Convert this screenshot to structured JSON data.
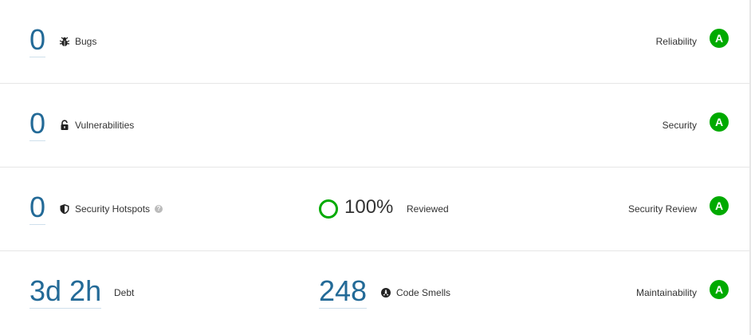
{
  "rows": [
    {
      "value": "0",
      "label": "Bugs",
      "icon": "bug-icon",
      "category": "Reliability",
      "rating": "A"
    },
    {
      "value": "0",
      "label": "Vulnerabilities",
      "icon": "lock-icon",
      "category": "Security",
      "rating": "A"
    },
    {
      "value": "0",
      "label": "Security Hotspots",
      "icon": "shield-icon",
      "help": "?",
      "review_percent": "100%",
      "review_label": "Reviewed",
      "category": "Security Review",
      "rating": "A"
    },
    {
      "value": "3d 2h",
      "label": "Debt",
      "smells_value": "248",
      "smells_label": "Code Smells",
      "smells_icon": "code-smell-icon",
      "category": "Maintainability",
      "rating": "A"
    }
  ],
  "colors": {
    "rating_a": "#00aa00",
    "link": "#236a97",
    "divider": "#e6e6e6"
  }
}
